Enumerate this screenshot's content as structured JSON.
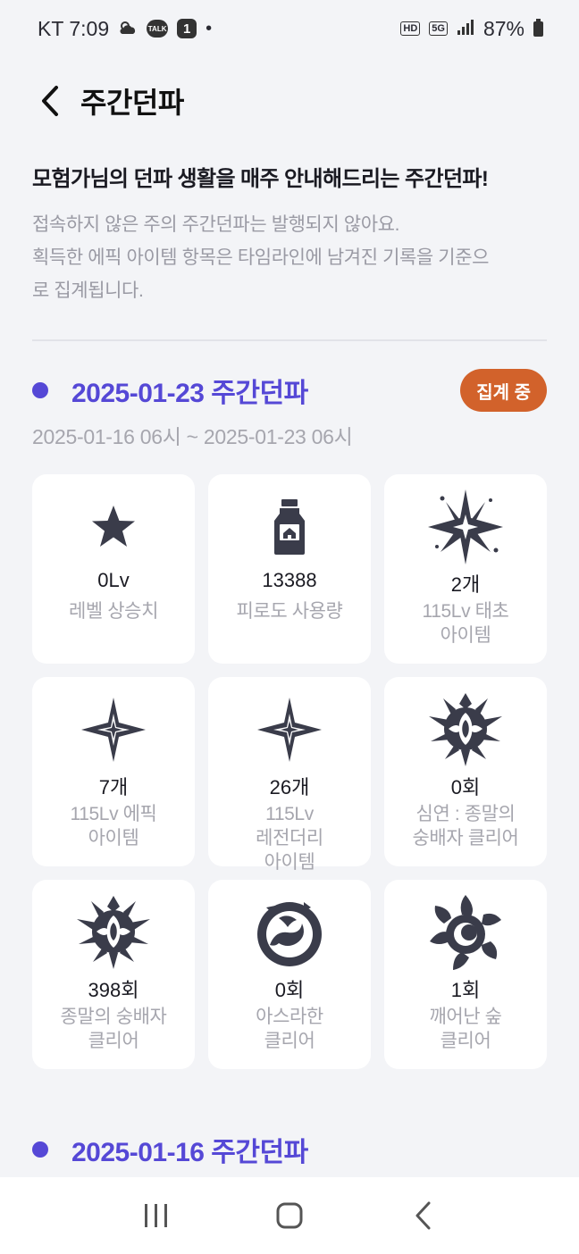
{
  "status_bar": {
    "carrier_time": "KT 7:09",
    "talk_label": "TALK",
    "notification_count": "1",
    "dot": "•",
    "hd_tag": "HD",
    "network_tag": "5G",
    "battery": "87%"
  },
  "header": {
    "title": "주간던파"
  },
  "intro": {
    "title": "모험가님의 던파 생활을 매주 안내해드리는 주간던파!",
    "line1": "접속하지 않은 주의 주간던파는 발행되지 않아요.",
    "line2": "획득한 에픽 아이템 항목은 타임라인에 남겨진 기록을 기준으",
    "line3": "로 집계됩니다."
  },
  "weeks": [
    {
      "title": "2025-01-23 주간던파",
      "badge": "집계 중",
      "range": "2025-01-16 06시 ~ 2025-01-23 06시",
      "cards": [
        {
          "icon": "star-icon",
          "value": "0Lv",
          "label": "레벨 상승치"
        },
        {
          "icon": "potion-bottle-icon",
          "value": "13388",
          "label": "피로도 사용량"
        },
        {
          "icon": "sparkle-burst-icon",
          "value": "2개",
          "label": "115Lv 태초\n아이템"
        },
        {
          "icon": "four-point-star-icon",
          "value": "7개",
          "label": "115Lv 에픽\n아이템"
        },
        {
          "icon": "four-point-star-icon",
          "value": "26개",
          "label": "115Lv\n레전더리\n아이템"
        },
        {
          "icon": "abyss-crest-icon",
          "value": "0회",
          "label": "심연 : 종말의\n숭배자 클리어"
        },
        {
          "icon": "abyss-crest-icon",
          "value": "398회",
          "label": "종말의 숭배자\n클리어"
        },
        {
          "icon": "dragon-ring-icon",
          "value": "0회",
          "label": "아스라한\n클리어"
        },
        {
          "icon": "dark-sun-icon",
          "value": "1회",
          "label": "깨어난 숲\n클리어"
        }
      ]
    },
    {
      "title": "2025-01-16 주간던파"
    }
  ],
  "colors": {
    "accent": "#5548d6",
    "badge": "#d2622b",
    "background": "#f3f4f7",
    "icon": "#3a3c4a"
  }
}
